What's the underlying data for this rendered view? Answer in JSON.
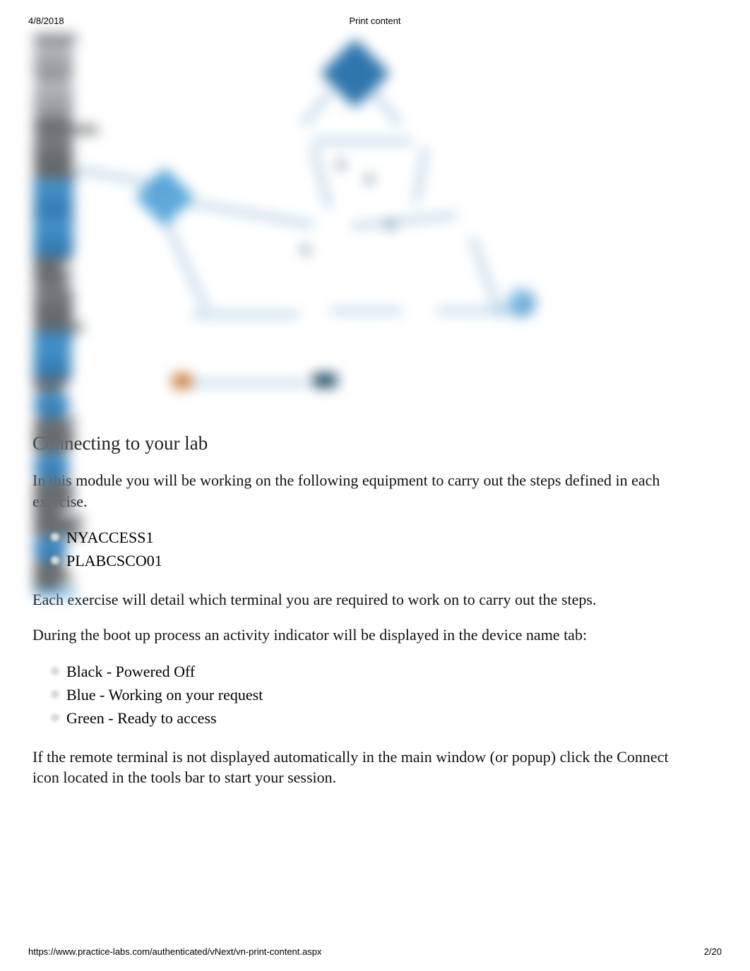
{
  "print_header": {
    "date": "4/8/2018",
    "title": "Print content"
  },
  "section_heading": "Connecting to your lab",
  "paragraphs": {
    "intro": "In this module you will be working on the following equipment to carry out the steps defined in each exercise.",
    "detail": "Each exercise will detail which terminal you are required to work on to carry out the steps.",
    "bootup": "During the boot up process an activity indicator will be displayed in the device name tab:",
    "remote_prefix": "If the remote terminal is not displayed automatically in the main window (or popup) click the",
    "connect_chip": "Connect",
    "remote_suffix": "icon located in the tools bar to start your session."
  },
  "devices": [
    "NYACCESS1",
    "PLABCSCO01"
  ],
  "statuses": [
    "Black - Powered Off",
    "Blue - Working on your request",
    "Green - Ready to access"
  ],
  "footer": {
    "url": "https://www.practice-labs.com/authenticated/vNext/vn-print-content.aspx",
    "page": "2/20"
  }
}
